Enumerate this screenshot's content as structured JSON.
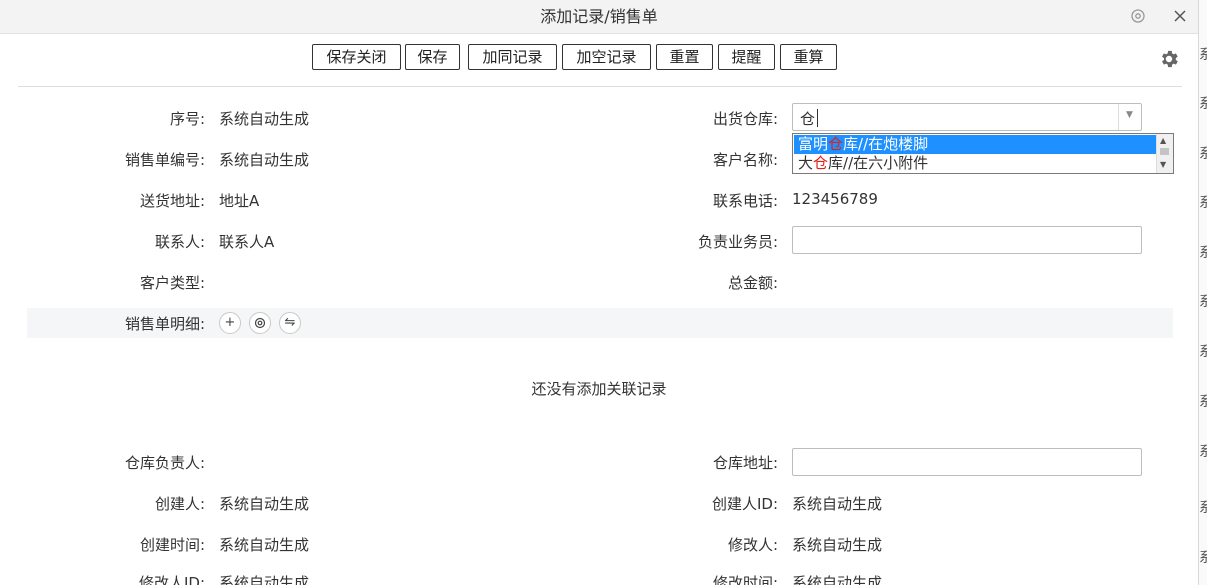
{
  "window": {
    "title": "添加记录/销售单"
  },
  "toolbar": {
    "buttons": [
      "保存关闭",
      "保存",
      "加同记录",
      "加空记录",
      "重置",
      "提醒",
      "重算"
    ]
  },
  "form": {
    "seq": {
      "label": "序号:",
      "value": "系统自动生成"
    },
    "order_no": {
      "label": "销售单编号:",
      "value": "系统自动生成"
    },
    "address": {
      "label": "送货地址:",
      "value": "地址A"
    },
    "contact": {
      "label": "联系人:",
      "value": "联系人A"
    },
    "customer_type": {
      "label": "客户类型:",
      "value": ""
    },
    "warehouse": {
      "label": "出货仓库:",
      "input_value": "仓",
      "options": [
        {
          "pre": "富明",
          "match": "仓",
          "post": "库//在炮楼脚"
        },
        {
          "pre": "大",
          "match": "仓",
          "post": "库//在六小附件"
        }
      ]
    },
    "customer_name": {
      "label": "客户名称:"
    },
    "phone": {
      "label": "联系电话:",
      "value": "123456789"
    },
    "salesperson": {
      "label": "负责业务员:",
      "value": ""
    },
    "total": {
      "label": "总金额:",
      "value": ""
    }
  },
  "detail": {
    "label": "销售单明细:",
    "empty_text": "还没有添加关联记录"
  },
  "footer_fields": {
    "wh_manager": {
      "label": "仓库负责人:"
    },
    "wh_address": {
      "label": "仓库地址:",
      "value": ""
    },
    "creator": {
      "label": "创建人:",
      "value": "系统自动生成"
    },
    "creator_id": {
      "label": "创建人ID:",
      "value": "系统自动生成"
    },
    "created_at": {
      "label": "创建时间:",
      "value": "系统自动生成"
    },
    "modifier": {
      "label": "修改人:",
      "value": "系统自动生成"
    },
    "modifier_id": {
      "label": "修改人ID:",
      "value": "系统自动生成"
    },
    "modified_at": {
      "label": "修改时间:",
      "value": "系统自动生成"
    }
  },
  "background": {
    "chars": [
      "系",
      "系",
      "系",
      "系",
      "系",
      "系",
      "系",
      "系",
      "系",
      "系",
      "系"
    ]
  },
  "colors": {
    "highlight": "#1e90ff",
    "match_text": "#e0201a"
  }
}
